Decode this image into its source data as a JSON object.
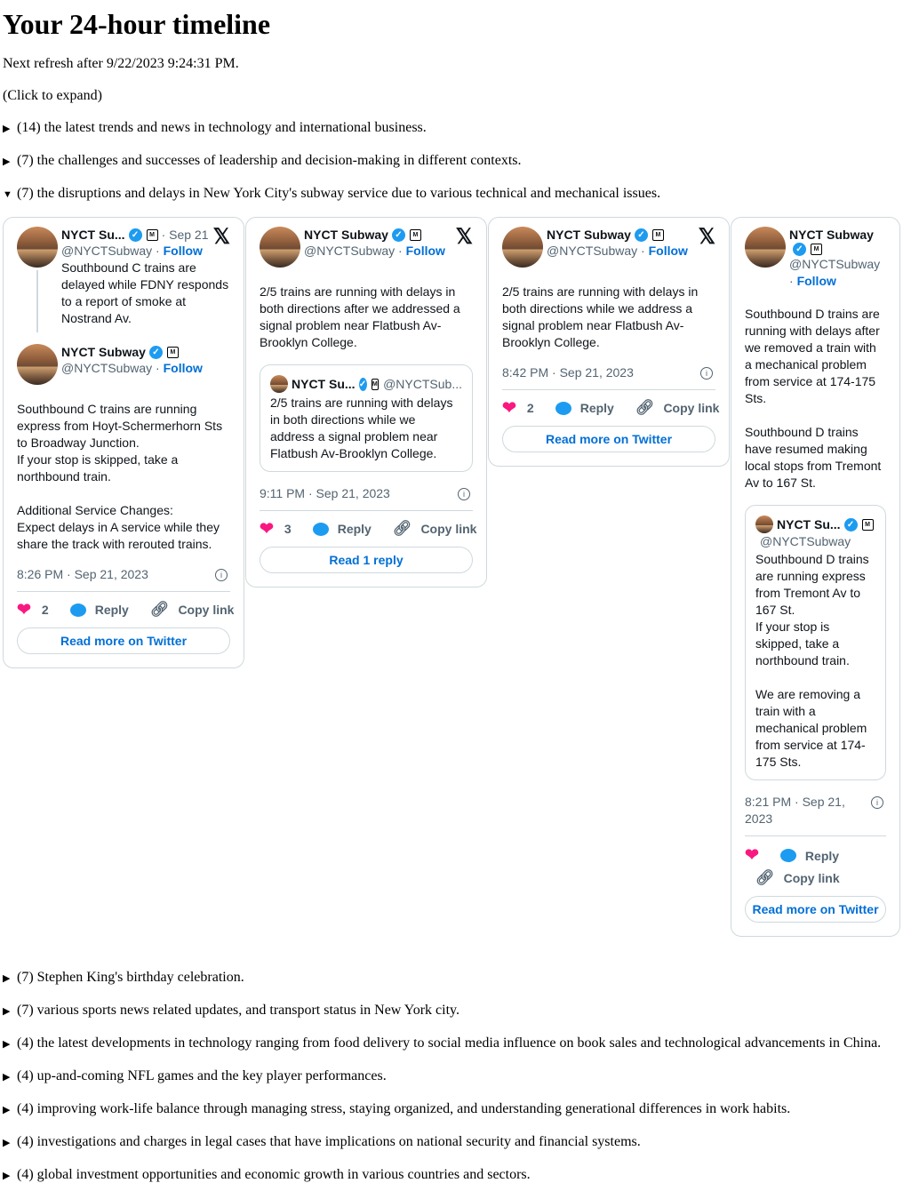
{
  "title": "Your 24-hour timeline",
  "refresh": "Next refresh after 9/22/2023 9:24:31 PM.",
  "hint": "(Click to expand)",
  "topics_before": [
    {
      "label": "(14) the latest trends and news in technology and international business."
    },
    {
      "label": "(7) the challenges and successes of leadership and decision-making in different contexts."
    }
  ],
  "open_topic": {
    "label": "(7) the disruptions and delays in New York City's subway service due to various technical and mechanical issues."
  },
  "topics_after": [
    {
      "label": "(7) Stephen King's birthday celebration."
    },
    {
      "label": "(7) various sports news related updates, and transport status in New York city."
    },
    {
      "label": "(4) the latest developments in technology ranging from food delivery to social media influence on book sales and technological advancements in China."
    },
    {
      "label": "(4) up-and-coming NFL games and the key player performances."
    },
    {
      "label": "(4) improving work-life balance through managing stress, staying organized, and understanding generational differences in work habits."
    },
    {
      "label": "(4) investigations and charges in legal cases that have implications on national security and financial systems."
    },
    {
      "label": "(4) global investment opportunities and economic growth in various countries and sectors."
    }
  ],
  "colors": {
    "like": "#f91880",
    "link": "#006fd6",
    "verified": "#1d9bf0"
  },
  "tweets": [
    {
      "parent": {
        "name": "NYCT Su...",
        "time": "· Sep 21",
        "handle": "@NYCTSubway",
        "follow": "Follow",
        "text": "Southbound C trains are delayed while FDNY responds to a report of smoke at Nostrand Av."
      },
      "name": "NYCT Subway",
      "handle": "@NYCTSubway",
      "follow": "Follow",
      "text": "Southbound C trains are running express from Hoyt-Schermerhorn Sts to Broadway Junction.\nIf your stop is skipped, take a northbound train.\n\nAdditional Service Changes:\nExpect delays in A service while they share the track with rerouted trains.",
      "timestamp": "8:26 PM · Sep 21, 2023",
      "likes": "2",
      "reply": "Reply",
      "copy": "Copy link",
      "button": "Read more on Twitter"
    },
    {
      "name": "NYCT Subway",
      "handle": "@NYCTSubway",
      "follow": "Follow",
      "text": "2/5 trains are running with delays in both directions after we addressed a signal problem near Flatbush Av-Brooklyn College.",
      "quote": {
        "name": "NYCT Su...",
        "handle": "@NYCTSub...",
        "text": "2/5 trains are running with delays in both directions while we address a signal problem near Flatbush Av-Brooklyn College."
      },
      "timestamp": "9:11 PM · Sep 21, 2023",
      "likes": "3",
      "reply": "Reply",
      "copy": "Copy link",
      "button": "Read 1 reply"
    },
    {
      "name": "NYCT Subway",
      "handle": "@NYCTSubway",
      "follow": "Follow",
      "text": "2/5 trains are running with delays in both directions while we address a signal problem near Flatbush Av-Brooklyn College.",
      "timestamp": "8:42 PM · Sep 21, 2023",
      "likes": "2",
      "reply": "Reply",
      "copy": "Copy link",
      "button": "Read more on Twitter"
    },
    {
      "name": "NYCT Subway",
      "handle": "@NYCTSubway",
      "follow": "Follow",
      "text": "Southbound D trains are running with delays after we removed a train with a mechanical problem from service at 174-175 Sts.\n\nSouthbound D trains have resumed making local stops from Tremont Av to 167 St.",
      "quote": {
        "name": "NYCT Su...",
        "handle": "@NYCTSubway",
        "text": "Southbound D trains are running express from Tremont Av to 167 St.\nIf your stop is skipped, take a northbound train.\n\nWe are removing a train with a mechanical problem from service at 174-175 Sts."
      },
      "timestamp": "8:21 PM · Sep 21, 2023",
      "likes": "",
      "reply": "Reply",
      "copy": "Copy link",
      "button": "Read more on Twitter"
    }
  ]
}
